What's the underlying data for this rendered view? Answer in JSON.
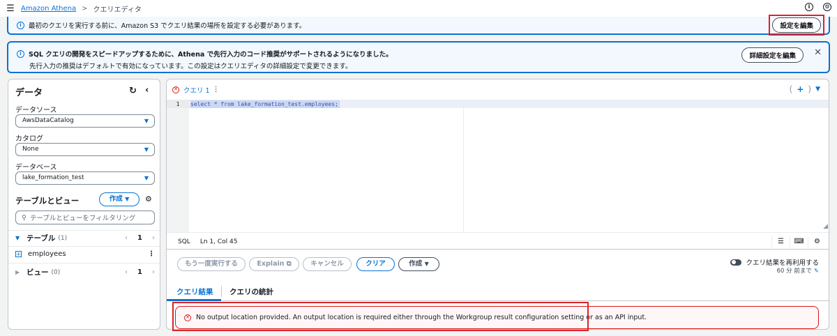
{
  "topbar": {
    "breadcrumb_root": "Amazon Athena",
    "breadcrumb_sep": ">",
    "breadcrumb_current": "クエリエディタ"
  },
  "alert_setup": {
    "message": "最初のクエリを実行する前に、Amazon S3 でクエリ結果の場所を設定する必要があります。",
    "button": "設定を編集"
  },
  "alert_suggest": {
    "title": "SQL クエリの開発をスピードアップするために、Athena で先行入力のコード推奨がサポートされるようになりました。",
    "body": "先行入力の推奨はデフォルトで有効になっています。この設定はクエリエディタの詳細設定で変更できます。",
    "button": "詳細設定を編集"
  },
  "data_panel": {
    "title": "データ",
    "source_label": "データソース",
    "source_value": "AwsDataCatalog",
    "catalog_label": "カタログ",
    "catalog_value": "None",
    "database_label": "データベース",
    "database_value": "lake_formation_test",
    "tables_views_title": "テーブルとビュー",
    "create_button": "作成",
    "filter_placeholder": "テーブルとビューをフィルタリング",
    "tables_label": "テーブル",
    "tables_count": "(1)",
    "tables_page": "1",
    "table_item": "employees",
    "views_label": "ビュー",
    "views_count": "(0)",
    "views_page": "1"
  },
  "editor": {
    "tab_name": "クエリ 1",
    "line_number": "1",
    "code": "select * from lake_formation_test.employees;",
    "lang": "SQL",
    "cursor": "Ln 1, Col 45"
  },
  "actions": {
    "run_again": "もう一度実行する",
    "explain": "Explain",
    "cancel": "キャンセル",
    "clear": "クリア",
    "create": "作成",
    "reuse_label": "クエリ結果を再利用する",
    "reuse_ago": "60 分 前まで"
  },
  "results": {
    "tab_results": "クエリ結果",
    "tab_stats": "クエリの統計",
    "error_message": "No output location provided. An output location is required either through the Workgroup result configuration setting or as an API input."
  },
  "colors": {
    "accent": "#0972d3",
    "error": "#d91515",
    "highlight_frame": "#d9232a"
  }
}
